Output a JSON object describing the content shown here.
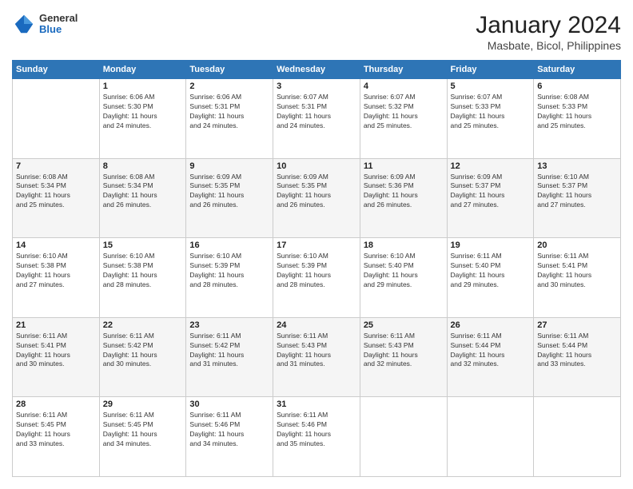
{
  "header": {
    "logo_general": "General",
    "logo_blue": "Blue",
    "title": "January 2024",
    "subtitle": "Masbate, Bicol, Philippines"
  },
  "columns": [
    "Sunday",
    "Monday",
    "Tuesday",
    "Wednesday",
    "Thursday",
    "Friday",
    "Saturday"
  ],
  "weeks": [
    [
      {
        "day": "",
        "info": ""
      },
      {
        "day": "1",
        "info": "Sunrise: 6:06 AM\nSunset: 5:30 PM\nDaylight: 11 hours\nand 24 minutes."
      },
      {
        "day": "2",
        "info": "Sunrise: 6:06 AM\nSunset: 5:31 PM\nDaylight: 11 hours\nand 24 minutes."
      },
      {
        "day": "3",
        "info": "Sunrise: 6:07 AM\nSunset: 5:31 PM\nDaylight: 11 hours\nand 24 minutes."
      },
      {
        "day": "4",
        "info": "Sunrise: 6:07 AM\nSunset: 5:32 PM\nDaylight: 11 hours\nand 25 minutes."
      },
      {
        "day": "5",
        "info": "Sunrise: 6:07 AM\nSunset: 5:33 PM\nDaylight: 11 hours\nand 25 minutes."
      },
      {
        "day": "6",
        "info": "Sunrise: 6:08 AM\nSunset: 5:33 PM\nDaylight: 11 hours\nand 25 minutes."
      }
    ],
    [
      {
        "day": "7",
        "info": "Sunrise: 6:08 AM\nSunset: 5:34 PM\nDaylight: 11 hours\nand 25 minutes."
      },
      {
        "day": "8",
        "info": "Sunrise: 6:08 AM\nSunset: 5:34 PM\nDaylight: 11 hours\nand 26 minutes."
      },
      {
        "day": "9",
        "info": "Sunrise: 6:09 AM\nSunset: 5:35 PM\nDaylight: 11 hours\nand 26 minutes."
      },
      {
        "day": "10",
        "info": "Sunrise: 6:09 AM\nSunset: 5:35 PM\nDaylight: 11 hours\nand 26 minutes."
      },
      {
        "day": "11",
        "info": "Sunrise: 6:09 AM\nSunset: 5:36 PM\nDaylight: 11 hours\nand 26 minutes."
      },
      {
        "day": "12",
        "info": "Sunrise: 6:09 AM\nSunset: 5:37 PM\nDaylight: 11 hours\nand 27 minutes."
      },
      {
        "day": "13",
        "info": "Sunrise: 6:10 AM\nSunset: 5:37 PM\nDaylight: 11 hours\nand 27 minutes."
      }
    ],
    [
      {
        "day": "14",
        "info": "Sunrise: 6:10 AM\nSunset: 5:38 PM\nDaylight: 11 hours\nand 27 minutes."
      },
      {
        "day": "15",
        "info": "Sunrise: 6:10 AM\nSunset: 5:38 PM\nDaylight: 11 hours\nand 28 minutes."
      },
      {
        "day": "16",
        "info": "Sunrise: 6:10 AM\nSunset: 5:39 PM\nDaylight: 11 hours\nand 28 minutes."
      },
      {
        "day": "17",
        "info": "Sunrise: 6:10 AM\nSunset: 5:39 PM\nDaylight: 11 hours\nand 28 minutes."
      },
      {
        "day": "18",
        "info": "Sunrise: 6:10 AM\nSunset: 5:40 PM\nDaylight: 11 hours\nand 29 minutes."
      },
      {
        "day": "19",
        "info": "Sunrise: 6:11 AM\nSunset: 5:40 PM\nDaylight: 11 hours\nand 29 minutes."
      },
      {
        "day": "20",
        "info": "Sunrise: 6:11 AM\nSunset: 5:41 PM\nDaylight: 11 hours\nand 30 minutes."
      }
    ],
    [
      {
        "day": "21",
        "info": "Sunrise: 6:11 AM\nSunset: 5:41 PM\nDaylight: 11 hours\nand 30 minutes."
      },
      {
        "day": "22",
        "info": "Sunrise: 6:11 AM\nSunset: 5:42 PM\nDaylight: 11 hours\nand 30 minutes."
      },
      {
        "day": "23",
        "info": "Sunrise: 6:11 AM\nSunset: 5:42 PM\nDaylight: 11 hours\nand 31 minutes."
      },
      {
        "day": "24",
        "info": "Sunrise: 6:11 AM\nSunset: 5:43 PM\nDaylight: 11 hours\nand 31 minutes."
      },
      {
        "day": "25",
        "info": "Sunrise: 6:11 AM\nSunset: 5:43 PM\nDaylight: 11 hours\nand 32 minutes."
      },
      {
        "day": "26",
        "info": "Sunrise: 6:11 AM\nSunset: 5:44 PM\nDaylight: 11 hours\nand 32 minutes."
      },
      {
        "day": "27",
        "info": "Sunrise: 6:11 AM\nSunset: 5:44 PM\nDaylight: 11 hours\nand 33 minutes."
      }
    ],
    [
      {
        "day": "28",
        "info": "Sunrise: 6:11 AM\nSunset: 5:45 PM\nDaylight: 11 hours\nand 33 minutes."
      },
      {
        "day": "29",
        "info": "Sunrise: 6:11 AM\nSunset: 5:45 PM\nDaylight: 11 hours\nand 34 minutes."
      },
      {
        "day": "30",
        "info": "Sunrise: 6:11 AM\nSunset: 5:46 PM\nDaylight: 11 hours\nand 34 minutes."
      },
      {
        "day": "31",
        "info": "Sunrise: 6:11 AM\nSunset: 5:46 PM\nDaylight: 11 hours\nand 35 minutes."
      },
      {
        "day": "",
        "info": ""
      },
      {
        "day": "",
        "info": ""
      },
      {
        "day": "",
        "info": ""
      }
    ]
  ]
}
